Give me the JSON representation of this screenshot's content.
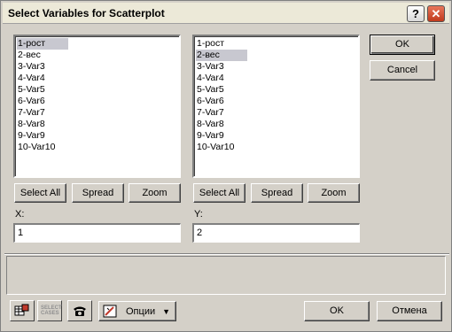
{
  "window": {
    "title": "Select Variables for Scatterplot",
    "help_glyph": "?",
    "close_glyph": "✕"
  },
  "left_list": {
    "items": [
      "1-рост",
      "2-вес",
      "3-Var3",
      "4-Var4",
      "5-Var5",
      "6-Var6",
      "7-Var7",
      "8-Var8",
      "9-Var9",
      "10-Var10"
    ],
    "selected_index": 0,
    "buttons": {
      "select_all": "Select All",
      "spread": "Spread",
      "zoom": "Zoom"
    },
    "field_label": "X:",
    "field_value": "1"
  },
  "right_list": {
    "items": [
      "1-рост",
      "2-вес",
      "3-Var3",
      "4-Var4",
      "5-Var5",
      "6-Var6",
      "7-Var7",
      "8-Var8",
      "9-Var9",
      "10-Var10"
    ],
    "selected_index": 1,
    "buttons": {
      "select_all": "Select All",
      "spread": "Spread",
      "zoom": "Zoom"
    },
    "field_label": "Y:",
    "field_value": "2"
  },
  "side_buttons": {
    "ok": "OK",
    "cancel": "Cancel"
  },
  "bottom_bar": {
    "select_cases_label": "SELECT CASES",
    "options_label": "Опции",
    "ok": "OK",
    "cancel": "Отмена"
  }
}
